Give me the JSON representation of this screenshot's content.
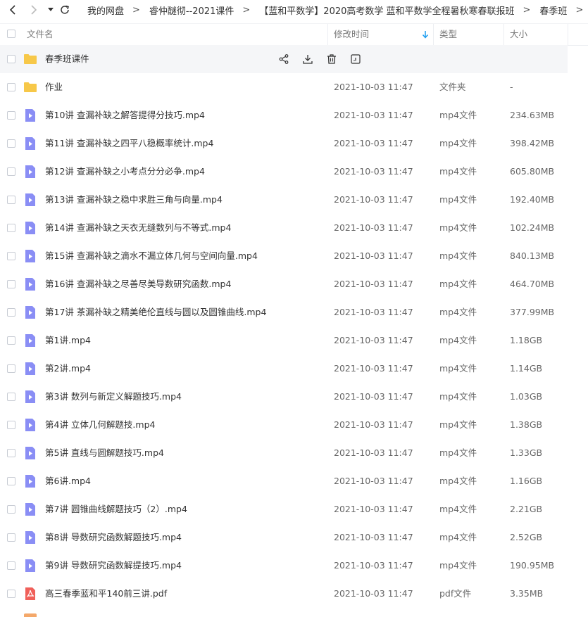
{
  "nav": {
    "back_icon": "chevron-left-icon",
    "forward_icon": "chevron-right-icon",
    "dropdown_icon": "caret-down-icon",
    "refresh_icon": "refresh-icon"
  },
  "breadcrumb": [
    "我的网盘",
    "睿仲醚彻--2021课件",
    "【蓝和平数学】2020高考数学 蓝和平数学全程暑秋寒春联报班",
    "春季班"
  ],
  "breadcrumb_separator": ">",
  "header": {
    "name": "文件名",
    "modified": "修改时间",
    "type": "类型",
    "size": "大小",
    "sort_icon": "sort-down-arrow-icon",
    "sort_color": "#1a9cf0"
  },
  "hover_actions": [
    "share-icon",
    "download-icon",
    "delete-icon",
    "more-icon"
  ],
  "colors": {
    "folder": "#f7c849",
    "video": "#8a8ef5",
    "pdf": "#f0605a"
  },
  "files": [
    {
      "name": "春季班课件",
      "time": "",
      "type": "",
      "size": "",
      "kind": "folder"
    },
    {
      "name": "作业",
      "time": "2021-10-03 11:47",
      "type": "文件夹",
      "size": "-",
      "kind": "folder"
    },
    {
      "name": "第10讲 查漏补缺之解答提得分技巧.mp4",
      "time": "2021-10-03 11:47",
      "type": "mp4文件",
      "size": "234.63MB",
      "kind": "video"
    },
    {
      "name": "第11讲 查漏补缺之四平八稳概率统计.mp4",
      "time": "2021-10-03 11:47",
      "type": "mp4文件",
      "size": "398.42MB",
      "kind": "video"
    },
    {
      "name": "第12讲 查漏补缺之小考点分分必争.mp4",
      "time": "2021-10-03 11:47",
      "type": "mp4文件",
      "size": "605.80MB",
      "kind": "video"
    },
    {
      "name": "第13讲 查漏补缺之稳中求胜三角与向量.mp4",
      "time": "2021-10-03 11:47",
      "type": "mp4文件",
      "size": "192.40MB",
      "kind": "video"
    },
    {
      "name": "第14讲 查漏补缺之天衣无缝数列与不等式.mp4",
      "time": "2021-10-03 11:47",
      "type": "mp4文件",
      "size": "102.24MB",
      "kind": "video"
    },
    {
      "name": "第15讲 查漏补缺之滴水不漏立体几何与空间向量.mp4",
      "time": "2021-10-03 11:47",
      "type": "mp4文件",
      "size": "840.13MB",
      "kind": "video"
    },
    {
      "name": "第16讲 查漏补缺之尽善尽美导数研究函数.mp4",
      "time": "2021-10-03 11:47",
      "type": "mp4文件",
      "size": "464.70MB",
      "kind": "video"
    },
    {
      "name": "第17讲 茶漏补缺之精美绝伦直线与圆以及圆锥曲线.mp4",
      "time": "2021-10-03 11:47",
      "type": "mp4文件",
      "size": "377.99MB",
      "kind": "video"
    },
    {
      "name": "第1讲.mp4",
      "time": "2021-10-03 11:47",
      "type": "mp4文件",
      "size": "1.18GB",
      "kind": "video"
    },
    {
      "name": "第2讲.mp4",
      "time": "2021-10-03 11:47",
      "type": "mp4文件",
      "size": "1.14GB",
      "kind": "video"
    },
    {
      "name": "第3讲 数列与新定义解题技巧.mp4",
      "time": "2021-10-03 11:47",
      "type": "mp4文件",
      "size": "1.03GB",
      "kind": "video"
    },
    {
      "name": "第4讲 立体几何解题技.mp4",
      "time": "2021-10-03 11:47",
      "type": "mp4文件",
      "size": "1.38GB",
      "kind": "video"
    },
    {
      "name": "第5讲 直线与圆解题技巧.mp4",
      "time": "2021-10-03 11:47",
      "type": "mp4文件",
      "size": "1.33GB",
      "kind": "video"
    },
    {
      "name": "第6讲.mp4",
      "time": "2021-10-03 11:47",
      "type": "mp4文件",
      "size": "1.16GB",
      "kind": "video"
    },
    {
      "name": "第7讲 圆锥曲线解题技巧（2）.mp4",
      "time": "2021-10-03 11:47",
      "type": "mp4文件",
      "size": "2.21GB",
      "kind": "video"
    },
    {
      "name": "第8讲 导数研究函数解题技巧.mp4",
      "time": "2021-10-03 11:47",
      "type": "mp4文件",
      "size": "2.52GB",
      "kind": "video"
    },
    {
      "name": "第9讲 导数研究函数解提技巧.mp4",
      "time": "2021-10-03 11:47",
      "type": "mp4文件",
      "size": "190.95MB",
      "kind": "video"
    },
    {
      "name": "高三春季蓝和平140前三讲.pdf",
      "time": "2021-10-03 11:47",
      "type": "pdf文件",
      "size": "3.35MB",
      "kind": "pdf"
    }
  ]
}
